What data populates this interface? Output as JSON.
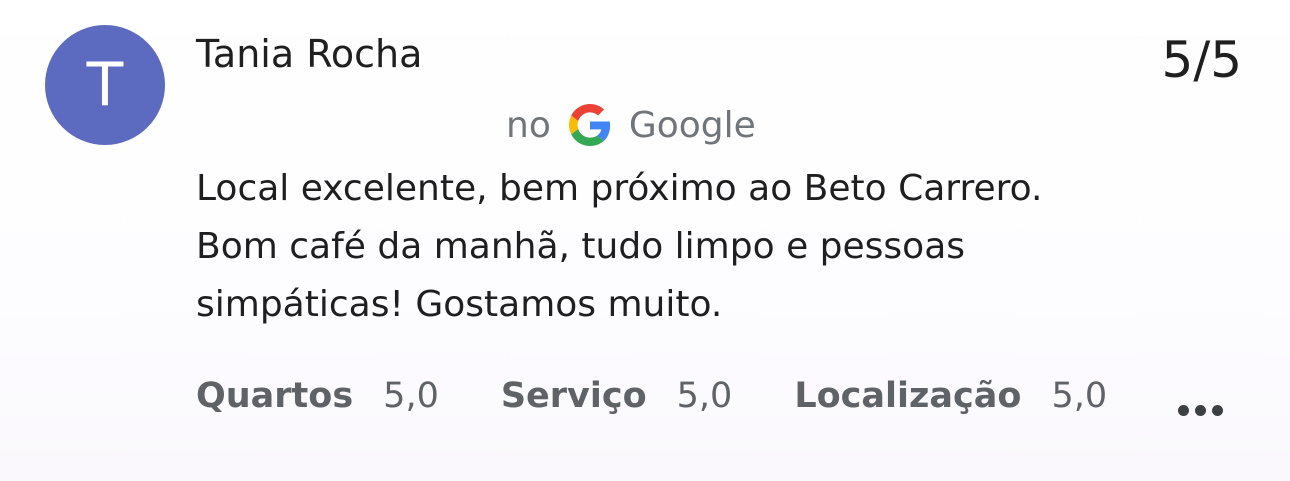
{
  "review": {
    "avatar_letter": "T",
    "avatar_color": "#5c6bc0",
    "reviewer_name": "Tania Rocha",
    "score": "5/5",
    "source_prefix": "no",
    "source_name": "Google",
    "source_icon": "google-g-icon",
    "text_lines": [
      "Local excelente, bem próximo ao Beto Carrero.",
      "Bom café da manhã, tudo limpo e pessoas",
      "simpáticas! Gostamos muito."
    ],
    "ratings": [
      {
        "label": "Quartos",
        "value": "5,0"
      },
      {
        "label": "Serviço",
        "value": "5,0"
      },
      {
        "label": "Localização",
        "value": "5,0"
      }
    ],
    "more_icon": "more-horizontal-icon"
  }
}
